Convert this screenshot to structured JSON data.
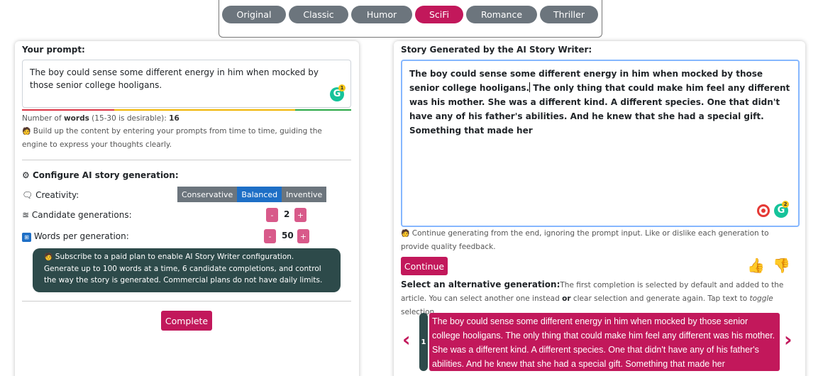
{
  "genres": [
    {
      "label": "Original",
      "active": false
    },
    {
      "label": "Classic",
      "active": false
    },
    {
      "label": "Humor",
      "active": false
    },
    {
      "label": "SciFi",
      "active": true
    },
    {
      "label": "Romance",
      "active": false
    },
    {
      "label": "Thriller",
      "active": false
    }
  ],
  "left": {
    "prompt_label": "Your prompt:",
    "prompt_text": "The boy could sense some different energy in him when mocked by those senior college hooligans.",
    "grammarly_count": "1",
    "word_count_prefix": "Number of ",
    "word_count_bold": "words",
    "word_count_range": " (15-30 is desirable): ",
    "word_count_value": "16",
    "tip_text": "Build up the content by entering your prompts from time to time, guiding the engine to express your thoughts clearly.",
    "config_title": "Configure AI story generation:",
    "creativity_label": "Creativity:",
    "creativity_options": [
      "Conservative",
      "Balanced",
      "Inventive"
    ],
    "creativity_selected": "Balanced",
    "candidates_label": "Candidate generations:",
    "candidates_value": "2",
    "words_label": "Words per generation:",
    "words_value": "50",
    "minus": "-",
    "plus": "+",
    "subscribe_text": "Subscribe to a paid plan to enable AI Story Writer configuration. Generate up to 100 words at a time, 6 candidate completions, and control the way the story is generated. Commercial plans do not have daily limits.",
    "complete_button": "Complete"
  },
  "right": {
    "story_label": "Story Generated by the AI Story Writer:",
    "story_text_before_caret": "The boy could sense some different energy in him when mocked by those senior college hooligans.",
    "story_text_after_caret": " The only thing that could make him feel any different was his mother. She was a different kind. A different species. One that didn't have any of his father's abilities. And he knew that she had a special gift. Something that made her",
    "grammarly_count": "2",
    "continue_tip": "Continue generating from the end, ignoring the prompt input. Like or dislike each generation to provide quality feedback.",
    "continue_button": "Continue",
    "alt_title_bold": "Select an alternative generation:",
    "alt_desc_1": "The first completion is selected by default and added to the article. You can select another one instead ",
    "alt_desc_or": "or",
    "alt_desc_2": " clear selection and generate again. Tap text to ",
    "alt_desc_toggle": "toggle",
    "alt_desc_3": " selection.",
    "alt_index": "1",
    "alt_text": "The boy could sense some different energy in him when mocked by those senior college hooligans. The only thing that could make him feel any different was his mother. She was a different kind. A different species. One that didn't have any of his father's abilities. And he knew that she had a special gift. Something that made her"
  },
  "colors": {
    "accent": "#c2185b",
    "dark_teal": "#2d4a4a",
    "selected_blue": "#1e6fc6",
    "grey": "#6c757d"
  }
}
